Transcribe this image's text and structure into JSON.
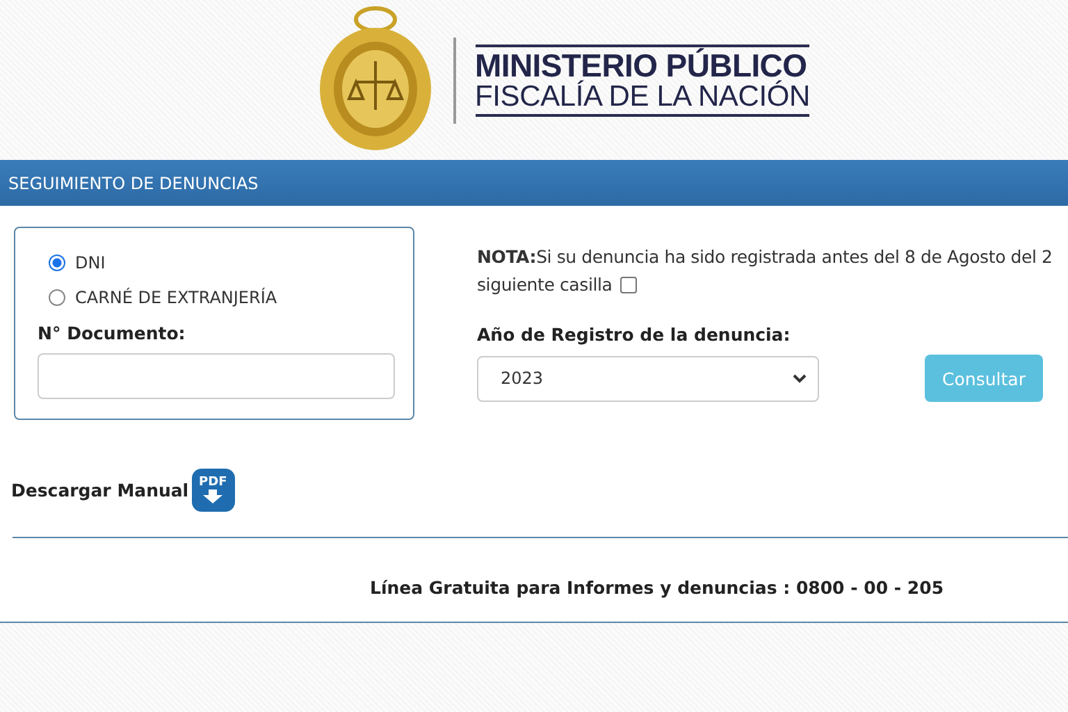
{
  "header": {
    "title": "MINISTERIO PÚBLICO",
    "subtitle": "FISCALÍA DE LA NACIÓN"
  },
  "section_bar": {
    "title": "SEGUIMIENTO DE DENUNCIAS"
  },
  "document_types": [
    {
      "label": "DNI",
      "selected": true
    },
    {
      "label": "CARNÉ DE EXTRANJERÍA",
      "selected": false
    }
  ],
  "document_field": {
    "label": "N° Documento:"
  },
  "note": {
    "text": "**NOTA:**Si su denuncia ha sido registrada antes del 8 de Agosto del 2",
    "continuation": "siguiente casilla",
    "checked": false
  },
  "year_select": {
    "label": "Año de Registro de la denuncia:",
    "value": "2023"
  },
  "consult_button": {
    "label": "Consultar"
  },
  "manual_link": {
    "label": "Descargar Manual",
    "icon_text": "PDF"
  },
  "hotline": "Línea Gratuita para Informes y denuncias : 0800 - 00 - 205"
}
